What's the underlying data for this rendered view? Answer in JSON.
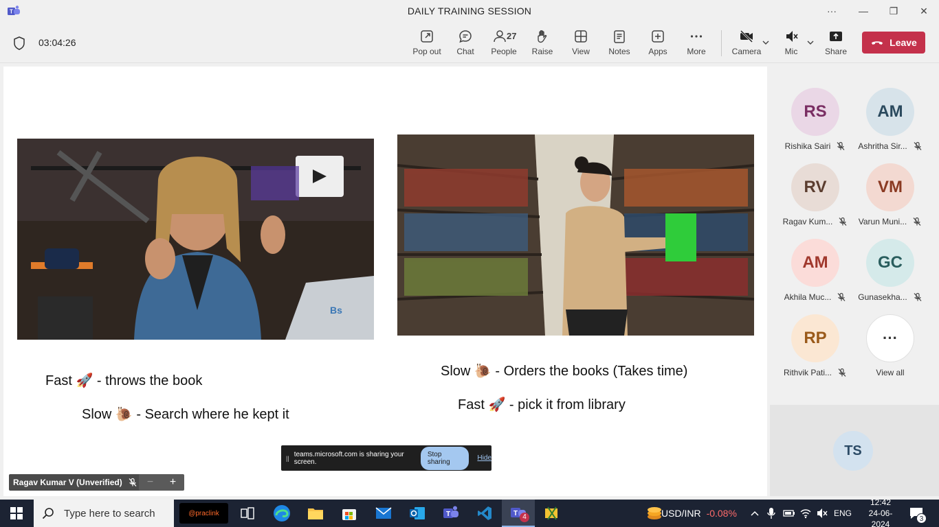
{
  "window": {
    "title": "DAILY TRAINING SESSION",
    "more": "···",
    "minimize": "—",
    "restore": "❐",
    "close": "✕"
  },
  "toolbar": {
    "timer": "03:04:26",
    "popout": "Pop out",
    "chat": "Chat",
    "people": "People",
    "people_count": "27",
    "raise": "Raise",
    "view": "View",
    "notes": "Notes",
    "apps": "Apps",
    "more": "More",
    "camera": "Camera",
    "mic": "Mic",
    "share": "Share",
    "leave": "Leave"
  },
  "slide": {
    "left_line1": "Fast 🚀 - throws the book",
    "left_line2": "Slow 🐌 - Search where he kept it",
    "right_line1": "Slow 🐌 - Orders the books (Takes time)",
    "right_line2": "Fast 🚀  - pick it from library"
  },
  "sharing_bar": {
    "pause": "||",
    "message": "teams.microsoft.com is sharing your screen.",
    "stop": "Stop sharing",
    "hide": "Hide"
  },
  "presenter": {
    "name": "Ragav Kumar V (Unverified)",
    "zoom_out": "−",
    "zoom_in": "+"
  },
  "participants": [
    {
      "initials": "RS",
      "name": "Rishika Sairi",
      "bg": "#ead7e6",
      "fg": "#7a2e63"
    },
    {
      "initials": "AM",
      "name": "Ashritha Sir...",
      "bg": "#d7e3ea",
      "fg": "#2b4a5e"
    },
    {
      "initials": "RV",
      "name": "Ragav Kum...",
      "bg": "#e8dcd6",
      "fg": "#5b3d2f"
    },
    {
      "initials": "VM",
      "name": "Varun Muni...",
      "bg": "#f3d9d1",
      "fg": "#8a3a22"
    },
    {
      "initials": "AM",
      "name": "Akhila Muc...",
      "bg": "#fbdcd9",
      "fg": "#a0382d"
    },
    {
      "initials": "GC",
      "name": "Gunasekha...",
      "bg": "#d5eaea",
      "fg": "#2a5e5e"
    },
    {
      "initials": "RP",
      "name": "Rithvik Pati...",
      "bg": "#fbe7d3",
      "fg": "#9a5a1a"
    }
  ],
  "view_all": {
    "label": "View all",
    "glyph": "···"
  },
  "self": {
    "initials": "TS"
  },
  "taskbar": {
    "search_placeholder": "Type here to search",
    "ad_text": "@praclink",
    "teams_badge": "4",
    "ticker_name": "USD/INR",
    "ticker_value": "-0.08%",
    "language": "ENG",
    "time": "12:42",
    "date": "24-06-2024",
    "notifications": "3"
  }
}
